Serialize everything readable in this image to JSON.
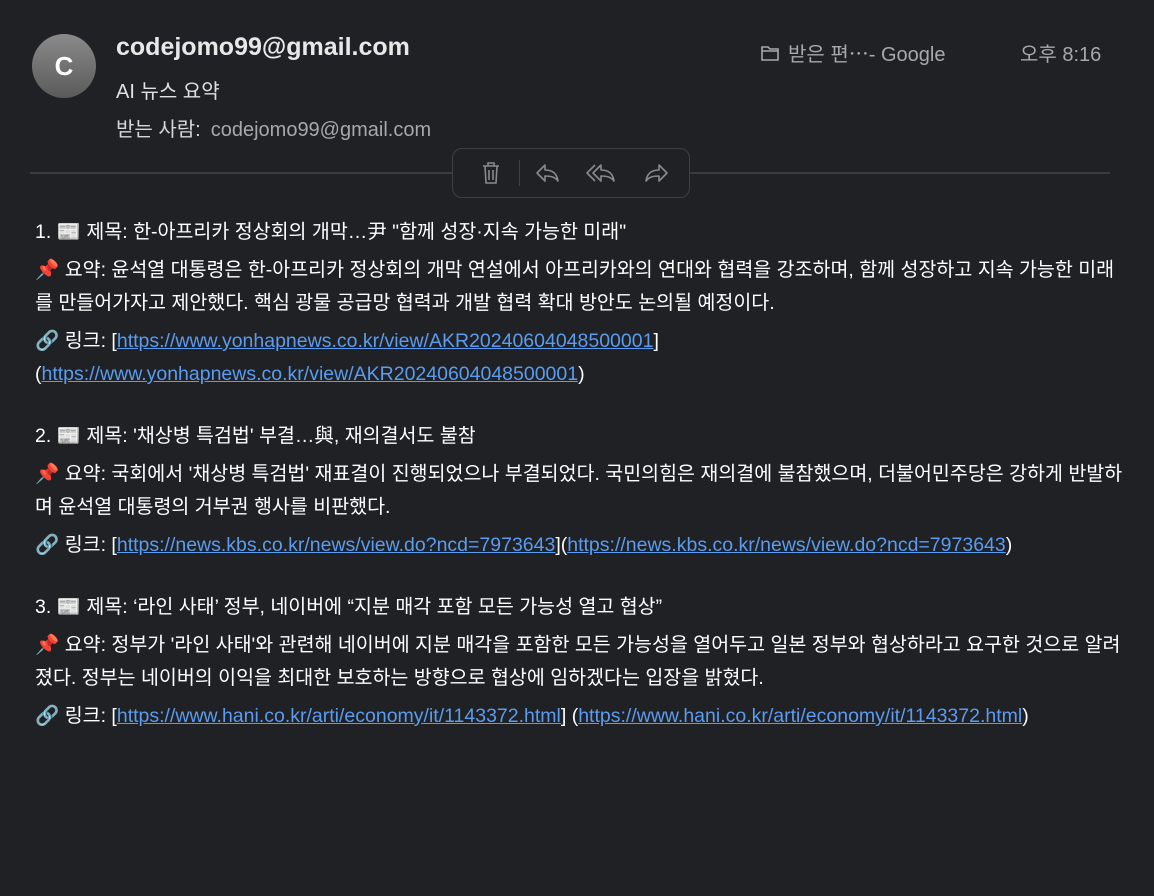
{
  "header": {
    "avatar_letter": "C",
    "sender": "codejomo99@gmail.com",
    "subject": "AI 뉴스 요약",
    "recipient_label": "받는 사람:",
    "recipient": "codejomo99@gmail.com",
    "mailbox": "받은 편⋯- Google",
    "time": "오후 8:16"
  },
  "toolbar": {
    "icons": [
      "trash-icon",
      "reply-icon",
      "reply-all-icon",
      "forward-icon"
    ]
  },
  "colors": {
    "background": "#1f2125",
    "link": "#5a9cf0"
  },
  "items": [
    {
      "title": "1. 📰 제목: 한-아프리카 정상회의 개막…尹 \"함께 성장·지속 가능한 미래\"",
      "summary": "📌 요약: 윤석열 대통령은 한-아프리카 정상회의 개막 연설에서 아프리카와의 연대와 협력을 강조하며, 함께 성장하고 지속 가능한 미래를 만들어가자고 제안했다. 핵심 광물 공급망 협력과 개발 협력 확대 방안도 논의될 예정이다.",
      "link_label": "🔗 링크: ",
      "url": "https://www.yonhapnews.co.kr/view/AKR20240604048500001"
    },
    {
      "title": "2. 📰 제목: '채상병 특검법' 부결…與, 재의결서도 불참",
      "summary": "📌 요약: 국회에서 '채상병 특검법' 재표결이 진행되었으나 부결되었다. 국민의힘은 재의결에 불참했으며, 더불어민주당은 강하게 반발하며 윤석열 대통령의 거부권 행사를 비판했다.",
      "link_label": "🔗 링크: ",
      "url": "https://news.kbs.co.kr/news/view.do?ncd=7973643"
    },
    {
      "title": "3. 📰 제목: ‘라인 사태’ 정부, 네이버에 “지분 매각 포함 모든 가능성 열고 협상”",
      "summary": "📌 요약: 정부가 '라인 사태'와 관련해 네이버에 지분 매각을 포함한 모든 가능성을 열어두고 일본 정부와 협상하라고 요구한 것으로 알려졌다. 정부는 네이버의 이익을 최대한 보호하는 방향으로 협상에 임하겠다는 입장을 밝혔다.",
      "link_label": "🔗 링크: ",
      "url": "https://www.hani.co.kr/arti/economy/it/1143372.html"
    }
  ]
}
